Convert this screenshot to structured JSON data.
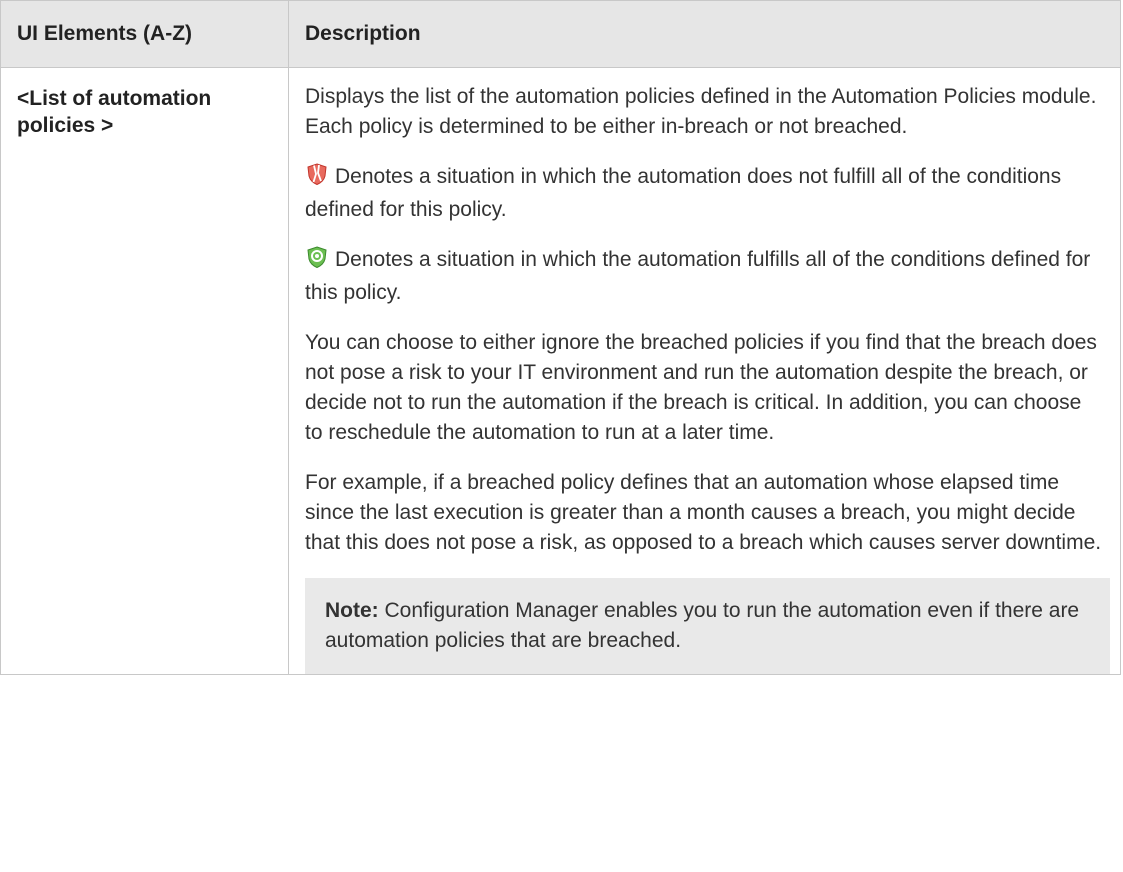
{
  "table": {
    "headers": {
      "col1": "UI Elements (A-Z)",
      "col2": "Description"
    },
    "row": {
      "element": "<List of automation policies >",
      "description": {
        "intro": "Displays the list of the automation policies defined in the Automation Policies module. Each policy is determined to be either in-breach or not breached.",
        "breached_text": "Denotes a situation in which the automation does not fulfill all of the conditions defined for this policy.",
        "breached_icon": "breached-policy-icon",
        "not_breached_text": "Denotes a situation in which the automation fulfills all of the conditions defined for this policy.",
        "not_breached_icon": "not-breached-policy-icon",
        "choose_text": "You can choose to either ignore the breached policies if you find that the breach does not pose a risk to your IT environment and run the automation despite the breach, or decide not to run the automation if the breach is critical. In addition, you can choose to reschedule the automation to run at a later time.",
        "example_text": "For example, if a breached policy defines that an automation whose elapsed time since the last execution is greater than a month causes a breach, you might decide that this does not pose a risk, as opposed to a breach which causes server downtime.",
        "note_label": "Note:",
        "note_text": " Configuration Manager enables you to run the automation even if there are automation policies that are breached."
      }
    }
  },
  "colors": {
    "header_bg": "#e6e6e6",
    "note_bg": "#e9e9e9",
    "border": "#c8c8c8",
    "breached_red": "#d9453c",
    "ok_green": "#4a9a3a"
  }
}
